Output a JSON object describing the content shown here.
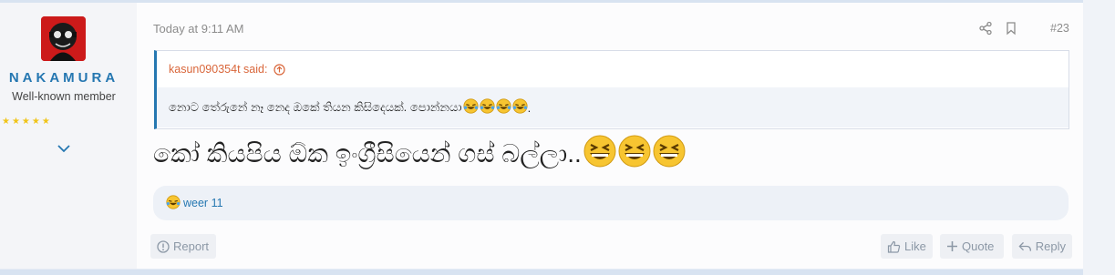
{
  "post": {
    "timestamp": "Today at 9:11 AM",
    "post_number": "#23",
    "user": {
      "name": "NAKAMURA",
      "title": "Well-known member",
      "stars": "★★★★★"
    },
    "quote": {
      "author_label": "kasun090354t said:",
      "text": "නොට තේරුනේ නෑ නෙද ඔකේ තියන කිසිදෙයක්. පොන්නයා ",
      "trailing": "."
    },
    "message": "කෝ කියපිය ඕක ඉංග්‍රීසියෙන් ගස් බල්ලා..",
    "reactions": {
      "text": "weer 11"
    },
    "buttons": {
      "report": "Report",
      "like": "Like",
      "quote": "Quote",
      "reply": "Reply"
    },
    "colors": {
      "accent": "#2577b1",
      "quote_author": "#d9663a",
      "muted": "#8c8c8c"
    }
  }
}
